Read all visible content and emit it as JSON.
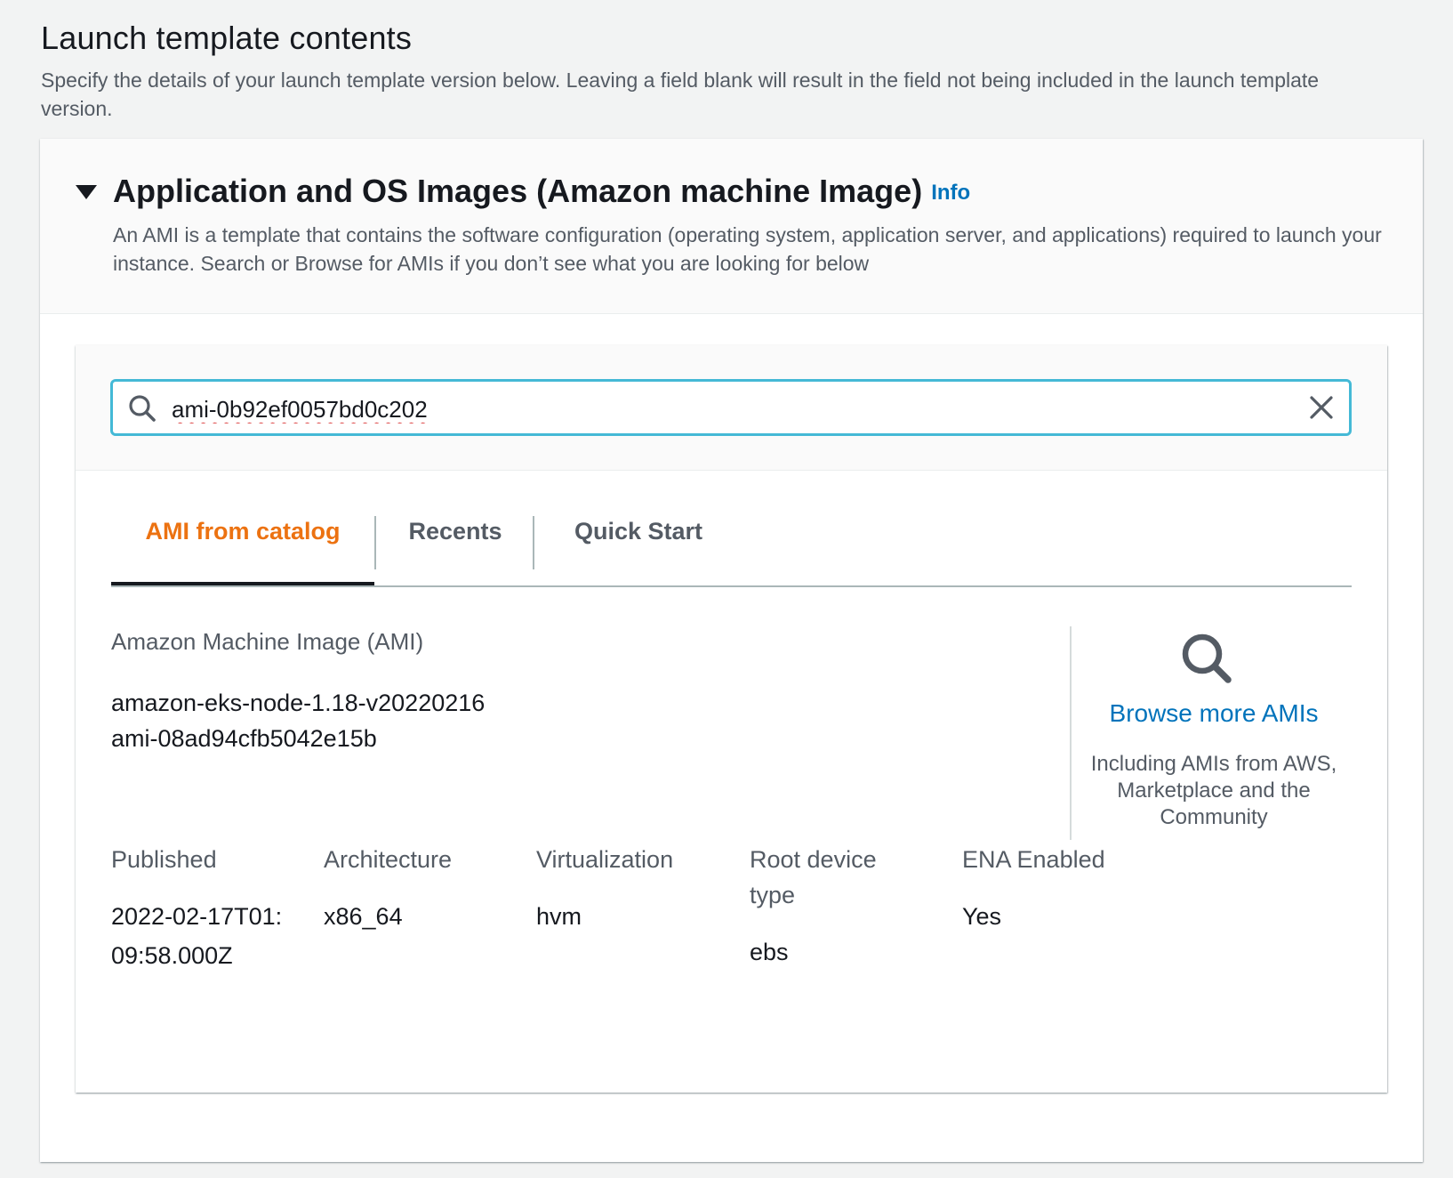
{
  "page": {
    "title": "Launch template contents",
    "description": "Specify the details of your launch template version below. Leaving a field blank will result in the field not being included in the launch template version."
  },
  "section": {
    "title": "Application and OS Images (Amazon machine Image)",
    "info_link": "Info",
    "description": "An AMI is a template that contains the software configuration (operating system, application server, and applications) required to launch your instance. Search or Browse for AMIs if you don’t see what you are looking for below"
  },
  "search": {
    "value": "ami-0b92ef0057bd0c202",
    "icon": "search-icon",
    "clear_icon": "close-icon"
  },
  "tabs": [
    {
      "label": "AMI from catalog",
      "active": true
    },
    {
      "label": "Recents",
      "active": false
    },
    {
      "label": "Quick Start",
      "active": false
    }
  ],
  "ami": {
    "label": "Amazon Machine Image (AMI)",
    "name": "amazon-eks-node-1.18-v20220216",
    "id": "ami-08ad94cfb5042e15b"
  },
  "browse": {
    "icon": "search-icon",
    "link": "Browse more AMIs",
    "description": "Including AMIs from AWS, Marketplace and the Community"
  },
  "attributes": [
    {
      "label": "Published",
      "value": "2022-02-17T01:09:58.000Z"
    },
    {
      "label": "Architecture",
      "value": "x86_64"
    },
    {
      "label": "Virtualization",
      "value": "hvm"
    },
    {
      "label": "Root device type",
      "value": "ebs"
    },
    {
      "label": "ENA Enabled",
      "value": "Yes"
    }
  ],
  "colors": {
    "accent_tab": "#ec7211",
    "link": "#0073bb",
    "focus_border": "#44b9d6"
  }
}
